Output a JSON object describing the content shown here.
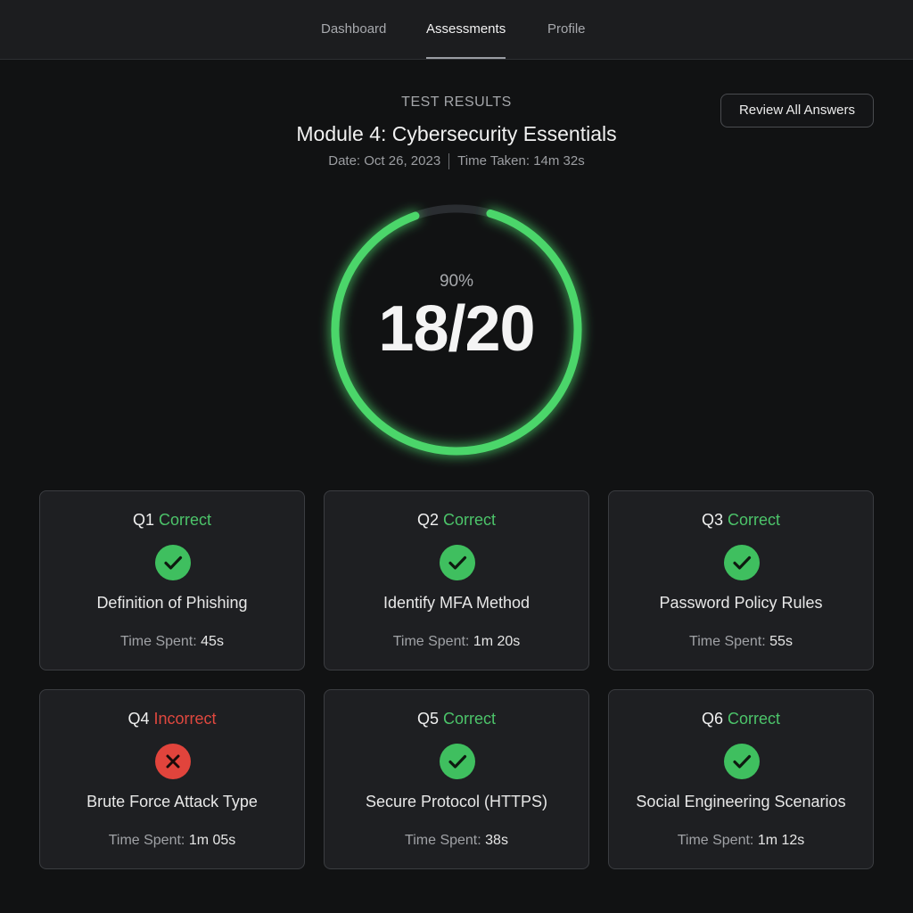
{
  "nav": {
    "tabs": [
      {
        "label": "Dashboard",
        "active": false
      },
      {
        "label": "Assessments",
        "active": true
      },
      {
        "label": "Profile",
        "active": false
      }
    ]
  },
  "results": {
    "eyebrow": "TEST RESULTS",
    "title": "Module 4: Cybersecurity Essentials",
    "date": "Date: Oct 26, 2023",
    "time_taken": "Time Taken: 14m 32s",
    "review_button": "Review All Answers"
  },
  "score": {
    "percent_label": "90%",
    "score_label": "18/20",
    "fraction": 0.9
  },
  "colors": {
    "correct": "#4cc46a",
    "incorrect": "#e0483f",
    "ring_track": "#2a2d31"
  },
  "time_spent_label": "Time Spent:",
  "questions": [
    {
      "q": "Q1",
      "status": "Correct",
      "correct": true,
      "icon": "check-icon",
      "topic": "Definition of Phishing",
      "time": "45s"
    },
    {
      "q": "Q2",
      "status": "Correct",
      "correct": true,
      "icon": "check-icon",
      "topic": "Identify MFA Method",
      "time": "1m 20s"
    },
    {
      "q": "Q3",
      "status": "Correct",
      "correct": true,
      "icon": "check-icon",
      "topic": "Password Policy Rules",
      "time": "55s"
    },
    {
      "q": "Q4",
      "status": "Incorrect",
      "correct": false,
      "icon": "x-icon",
      "topic": "Brute Force Attack Type",
      "time": "1m 05s"
    },
    {
      "q": "Q5",
      "status": "Correct",
      "correct": true,
      "icon": "check-icon",
      "topic": "Secure Protocol (HTTPS)",
      "time": "38s"
    },
    {
      "q": "Q6",
      "status": "Correct",
      "correct": true,
      "icon": "check-icon",
      "topic": "Social Engineering Scenarios",
      "time": "1m 12s"
    }
  ]
}
